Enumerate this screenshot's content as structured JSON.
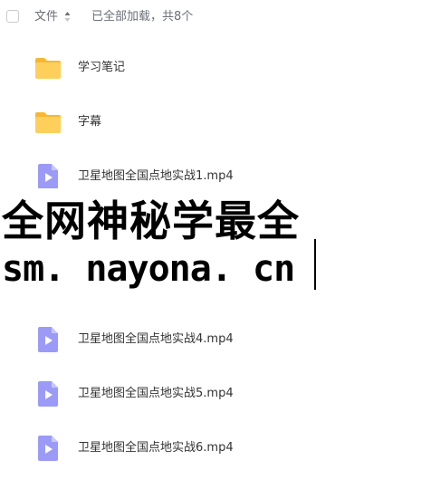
{
  "header": {
    "sort_label": "文件",
    "load_status": "已全部加载，共8个"
  },
  "files": [
    {
      "type": "folder",
      "name": "学习笔记"
    },
    {
      "type": "folder",
      "name": "字幕"
    },
    {
      "type": "video",
      "name": "卫星地图全国点地实战1.mp4"
    },
    {
      "type": "video",
      "name": "卫星地图全国点地实战4.mp4"
    },
    {
      "type": "video",
      "name": "卫星地图全国点地实战5.mp4"
    },
    {
      "type": "video",
      "name": "卫星地图全国点地实战6.mp4"
    }
  ],
  "overlay": {
    "line1": "全网神秘学最全",
    "line2": "sm. nayona. cn"
  },
  "colors": {
    "folder": "#FFCF5C",
    "folder_back": "#F7B733",
    "video": "#9B9BF7",
    "video_fold": "#C7C7FB",
    "muted_text": "#6B6F78"
  },
  "icons": {
    "folder": "folder-icon",
    "video": "video-file-icon",
    "sort": "sort-icon"
  }
}
